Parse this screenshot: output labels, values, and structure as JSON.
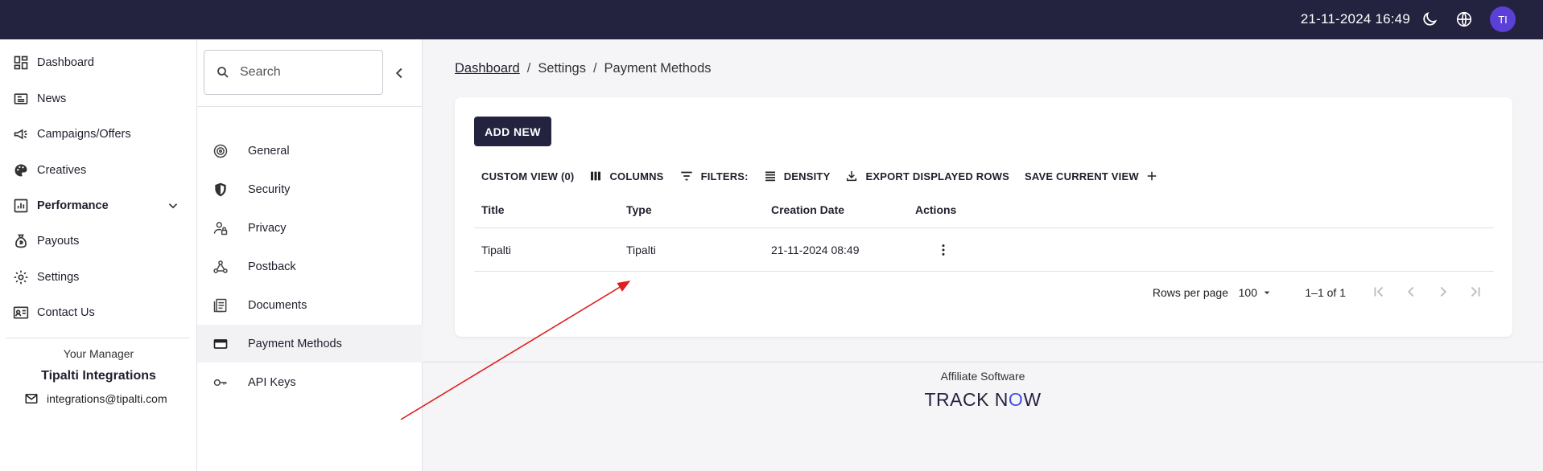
{
  "topbar": {
    "datetime": "21-11-2024 16:49",
    "avatar_initials": "TI",
    "icons": [
      "moon-icon",
      "globe-icon"
    ]
  },
  "sidebar": {
    "items": [
      {
        "label": "Dashboard",
        "icon": "dashboard-icon"
      },
      {
        "label": "News",
        "icon": "news-icon"
      },
      {
        "label": "Campaigns/Offers",
        "icon": "megaphone-icon"
      },
      {
        "label": "Creatives",
        "icon": "palette-icon"
      },
      {
        "label": "Performance",
        "icon": "chart-icon",
        "expandable": true
      },
      {
        "label": "Payouts",
        "icon": "money-bag-icon"
      },
      {
        "label": "Settings",
        "icon": "gear-icon"
      },
      {
        "label": "Contact Us",
        "icon": "contact-card-icon"
      }
    ],
    "manager": {
      "label": "Your Manager",
      "name": "Tipalti Integrations",
      "email": "integrations@tipalti.com"
    }
  },
  "submenu": {
    "search_placeholder": "Search",
    "items": [
      {
        "label": "General",
        "icon": "target-icon"
      },
      {
        "label": "Security",
        "icon": "shield-icon"
      },
      {
        "label": "Privacy",
        "icon": "user-lock-icon"
      },
      {
        "label": "Postback",
        "icon": "webhook-icon"
      },
      {
        "label": "Documents",
        "icon": "documents-icon"
      },
      {
        "label": "Payment Methods",
        "icon": "credit-card-icon",
        "active": true
      },
      {
        "label": "API Keys",
        "icon": "key-icon"
      }
    ]
  },
  "breadcrumb": {
    "items": [
      "Dashboard",
      "Settings",
      "Payment Methods"
    ],
    "separator": "/"
  },
  "card": {
    "add_button": "ADD NEW",
    "toolbar": {
      "custom_view": "CUSTOM VIEW (0)",
      "columns": "COLUMNS",
      "filters": "FILTERS:",
      "density": "DENSITY",
      "export": "EXPORT DISPLAYED ROWS",
      "save_view": "SAVE CURRENT VIEW"
    },
    "table": {
      "headers": [
        "Title",
        "Type",
        "Creation Date",
        "Actions"
      ],
      "rows": [
        {
          "title": "Tipalti",
          "type": "Tipalti",
          "created": "21-11-2024 08:49"
        }
      ]
    },
    "pagination": {
      "rows_per_page_label": "Rows per page",
      "rows_per_page": "100",
      "range": "1–1 of 1"
    }
  },
  "footer": {
    "text": "Affiliate Software",
    "logo_part1": "TRACK N",
    "logo_part2": "O",
    "logo_part3": "W"
  },
  "colors": {
    "topbar": "#23233f",
    "avatar": "#5b3fd6",
    "annotation_arrow": "#e02020",
    "logo_accent": "#4154d8"
  }
}
